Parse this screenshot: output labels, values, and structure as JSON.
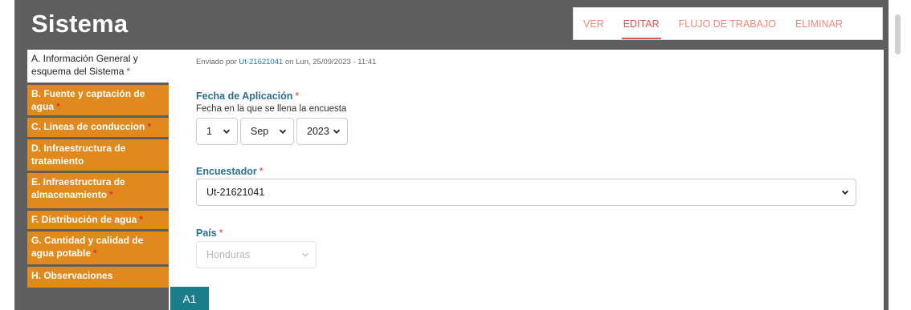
{
  "page": {
    "title": "Sistema"
  },
  "tabs": [
    {
      "label": "VER",
      "active": false
    },
    {
      "label": "EDITAR",
      "active": true
    },
    {
      "label": "FLUJO DE TRABAJO",
      "active": false
    },
    {
      "label": "ELIMINAR",
      "active": false
    }
  ],
  "sidebar": {
    "items": [
      {
        "label": "A. Información General y esquema del Sistema",
        "required": true,
        "active": true
      },
      {
        "label": "B. Fuente y captación de agua",
        "required": true,
        "active": false
      },
      {
        "label": "C. Lineas de conduccion",
        "required": true,
        "active": false
      },
      {
        "label": "D. Infraestructura de tratamiento",
        "required": false,
        "active": false
      },
      {
        "label": "E. Infraestructura de almacenamiento",
        "required": true,
        "active": false
      },
      {
        "label": "F. Distribución de agua",
        "required": true,
        "active": false
      },
      {
        "label": "G. Cantidad y calidad de agua potable",
        "required": true,
        "active": false
      },
      {
        "label": "H. Observaciones",
        "required": false,
        "active": false
      }
    ],
    "required_mark": "*"
  },
  "submission": {
    "prefix": "Enviado por",
    "user": "Ut-21621041",
    "suffix": "on Lun, 25/09/2023 - 11:41"
  },
  "form": {
    "fecha": {
      "label": "Fecha de Aplicación",
      "required_mark": "*",
      "help": "Fecha en la que se llena la encuesta",
      "day": "1",
      "month": "Sep",
      "year": "2023"
    },
    "encuestador": {
      "label": "Encuestador",
      "required_mark": "*",
      "value": "Ut-21621041"
    },
    "pais": {
      "label": "País",
      "required_mark": "*",
      "value": "Honduras",
      "disabled": true
    }
  },
  "badge": {
    "label": "A1"
  },
  "colors": {
    "frame": "#5e5e5e",
    "sidebar_item": "#e08a1e",
    "tab_text": "#ef8a7e",
    "tab_active": "#e0584a",
    "field_label": "#2b6f8f",
    "required": "#e0332b",
    "link": "#1f77b4",
    "badge": "#1b7d8a"
  },
  "icons": {
    "select_chevron": "chevron-down-icon"
  }
}
